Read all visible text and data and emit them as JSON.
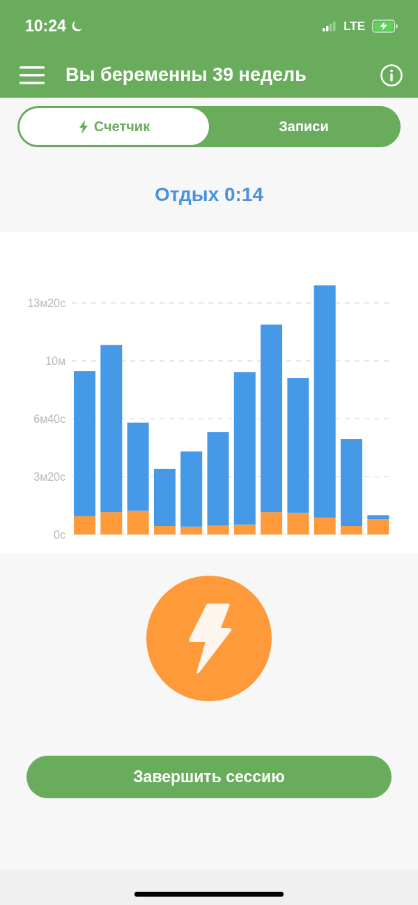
{
  "status_bar": {
    "time": "10:24",
    "network": "LTE"
  },
  "header": {
    "title": "Вы беременны 39 недель"
  },
  "tabs": [
    {
      "label": "Счетчик",
      "selected": true
    },
    {
      "label": "Записи",
      "selected": false
    }
  ],
  "rest_label": "Отдых 0:14",
  "chart": {
    "chart_data": {
      "type": "bar",
      "stacked": true,
      "grid": true,
      "ylim": [
        0,
        14.34
      ],
      "yticks": [
        {
          "value": 0,
          "label": "0с"
        },
        {
          "value": 3.333,
          "label": "3м20с"
        },
        {
          "value": 6.667,
          "label": "6м40с"
        },
        {
          "value": 10,
          "label": "10м"
        },
        {
          "value": 13.333,
          "label": "13м20с"
        }
      ],
      "series": [
        {
          "color": "#fe9a3a",
          "values": [
            1.05,
            1.28,
            1.37,
            0.48,
            0.45,
            0.52,
            0.57,
            1.28,
            1.25,
            0.97,
            0.48,
            0.88
          ]
        },
        {
          "color": "#4699e6",
          "values": [
            8.35,
            9.63,
            5.07,
            3.3,
            4.33,
            5.38,
            8.78,
            10.8,
            7.75,
            13.37,
            5.02,
            0.23
          ]
        }
      ]
    }
  },
  "end_button": "Завершить сессию"
}
